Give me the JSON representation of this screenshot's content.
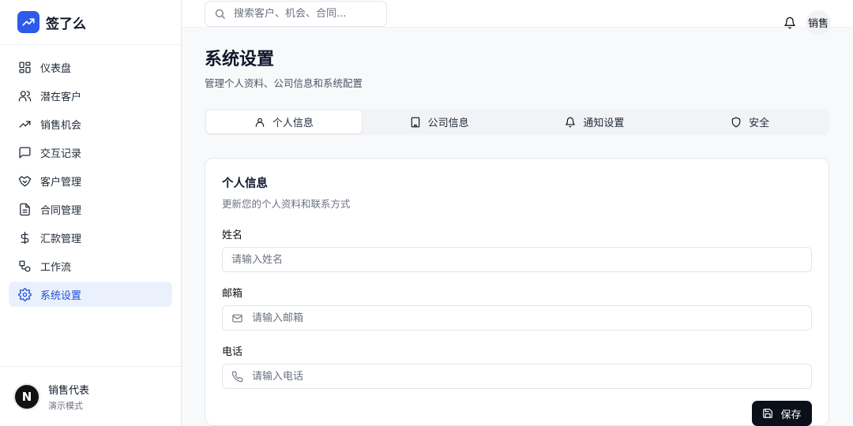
{
  "brand": {
    "name": "签了么",
    "logo_icon": "trending-up-icon",
    "accent": "#2f5bea"
  },
  "sidebar": {
    "items": [
      {
        "label": "仪表盘",
        "icon": "dashboard-icon",
        "active": false
      },
      {
        "label": "潜在客户",
        "icon": "users-icon",
        "active": false
      },
      {
        "label": "销售机会",
        "icon": "trending-up-icon",
        "active": false
      },
      {
        "label": "交互记录",
        "icon": "message-icon",
        "active": false
      },
      {
        "label": "客户管理",
        "icon": "handshake-icon",
        "active": false
      },
      {
        "label": "合同管理",
        "icon": "file-icon",
        "active": false
      },
      {
        "label": "汇款管理",
        "icon": "dollar-icon",
        "active": false
      },
      {
        "label": "工作流",
        "icon": "workflow-icon",
        "active": false
      },
      {
        "label": "系统设置",
        "icon": "settings-icon",
        "active": true
      }
    ],
    "user": {
      "avatar": "N",
      "name": "销售代表",
      "mode": "演示模式"
    }
  },
  "topbar": {
    "search_placeholder": "搜索客户、机会、合同...",
    "user_label": "销售"
  },
  "page": {
    "title": "系统设置",
    "subtitle": "管理个人资料、公司信息和系统配置"
  },
  "tabs": [
    {
      "label": "个人信息",
      "icon": "user-icon",
      "active": true
    },
    {
      "label": "公司信息",
      "icon": "building-icon",
      "active": false
    },
    {
      "label": "通知设置",
      "icon": "bell-icon",
      "active": false
    },
    {
      "label": "安全",
      "icon": "shield-icon",
      "active": false
    }
  ],
  "card": {
    "title": "个人信息",
    "subtitle": "更新您的个人资料和联系方式",
    "fields": [
      {
        "label": "姓名",
        "placeholder": "请输入姓名",
        "value": ""
      },
      {
        "label": "邮箱",
        "placeholder": "请输入邮箱",
        "value": ""
      },
      {
        "label": "电话",
        "placeholder": "请输入电话",
        "value": ""
      }
    ],
    "save_label": "保存"
  }
}
